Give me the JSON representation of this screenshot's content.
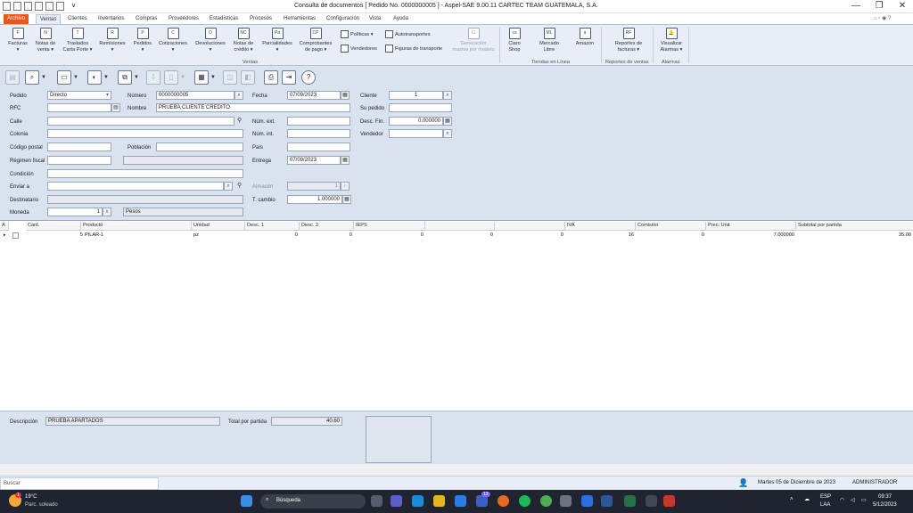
{
  "window": {
    "title": "Consulta de documentos [ Pedido No.          0000000005 ] - Aspel-SAE 9.00.11  CARTEC TEAM GUATEMALA, S.A.",
    "minimize": "—",
    "maximize": "❐",
    "close": "✕"
  },
  "menu_tabs": [
    "Archivo",
    "Ventas",
    "Clientes",
    "Inventarios",
    "Compras",
    "Proveedores",
    "Estadísticas",
    "Procesos",
    "Herramientas",
    "Configuración",
    "Vista",
    "Ayuda"
  ],
  "ribbon": {
    "buttons": [
      {
        "label": "Facturas",
        "sub": "▾"
      },
      {
        "label": "Notas de",
        "sub": "venta ▾"
      },
      {
        "label": "Traslados",
        "sub": "Carta Porte ▾"
      },
      {
        "label": "Remisiones",
        "sub": "▾"
      },
      {
        "label": "Pedidos",
        "sub": "▾"
      },
      {
        "label": "Cotizaciones",
        "sub": "▾"
      },
      {
        "label": "Devoluciones",
        "sub": "▾"
      },
      {
        "label": "Notas de",
        "sub": "crédito ▾"
      },
      {
        "label": "Parcialidades",
        "sub": "▾"
      },
      {
        "label": "Comprobantes",
        "sub": "de pago ▾"
      }
    ],
    "small_buttons": [
      "Políticas ▾",
      "Vendedores",
      "Autotransportes",
      "Figuras de transporte"
    ],
    "generacion": {
      "line1": "Generación",
      "line2": "masiva por modelo"
    },
    "group_ventas": "Ventas",
    "claro_shop": {
      "line1": "Claro",
      "line2": "Shop"
    },
    "mercado_libre": {
      "line1": "Mercado",
      "line2": "Libre"
    },
    "amazon": "Amazon",
    "group_tiendas": "Tiendas en Línea",
    "reportes": {
      "line1": "Reportes de",
      "line2": "facturas ▾"
    },
    "group_reportes": "Reportes de ventas",
    "alarmas": {
      "line1": "Visualizar",
      "line2": "Alarmas ▾"
    },
    "group_alarmas": "Alarmas"
  },
  "form": {
    "pedido_label": "Pedido",
    "pedido_value": "Directo",
    "numero_label": "Número",
    "numero_value": "0000000005",
    "fecha_label": "Fecha",
    "fecha_value": "07/09/2023",
    "cliente_label": "Cliente",
    "cliente_value": "1",
    "rfc_label": "RFC",
    "nombre_label": "Nombre",
    "nombre_value": "PRUEBA CLIENTE CREDITO",
    "su_pedido_label": "Su pedido",
    "calle_label": "Calle",
    "num_ext_label": "Núm. ext.",
    "desc_fin_label": "Desc. Fin.",
    "desc_fin_value": "0.000000",
    "colonia_label": "Colonia",
    "num_int_label": "Núm. int.",
    "vendedor_label": "Vendedor",
    "codigo_postal_label": "Código postal",
    "poblacion_label": "Población",
    "pais_label": "País",
    "regimen_label": "Régimen fiscal",
    "entrega_label": "Entrega",
    "entrega_value": "07/09/2023",
    "condicion_label": "Condición",
    "enviar_label": "Enviar a",
    "almacen_label": "Almacén",
    "almacen_value": "1",
    "destinatario_label": "Destinatario",
    "tcambio_label": "T. cambio",
    "tcambio_value": "1.000000",
    "moneda_label": "Moneda",
    "moneda_value": "1",
    "moneda_name": "Pesos"
  },
  "grid": {
    "headers": [
      "A",
      "Cant.",
      "Producto",
      "Unidad",
      "Desc. 1",
      "Desc. 2",
      "IEPS",
      "",
      "",
      "IVA",
      "Comisión",
      "Prec. Unit",
      "Subtotal por partida"
    ],
    "rows": [
      {
        "cant": "5",
        "producto": "PILAR-1",
        "unidad": "pz",
        "desc1": "0",
        "desc2": "0",
        "ieps": "0",
        "c7": "0",
        "c8": "0",
        "iva": "16",
        "comision": "0",
        "prec": "7.000000",
        "subtotal": "35.00"
      }
    ]
  },
  "bottom": {
    "descripcion_label": "Descripción",
    "descripcion_value": "PRUEBA APARTADOS",
    "total_label": "Total por partida",
    "total_value": "40.60"
  },
  "statusbar": {
    "search_placeholder": "Buscar",
    "date": "Martes 05 de Diciembre de 2023",
    "user": "ADMINISTRADOR"
  },
  "taskbar": {
    "weather_temp": "19°C",
    "weather_desc": "Parc. soleado",
    "weather_badge": "1",
    "search": "Búsqueda",
    "badge_count": "13",
    "lang1": "ESP",
    "lang2": "LAA",
    "time": "09:37",
    "date": "5/12/2023"
  }
}
